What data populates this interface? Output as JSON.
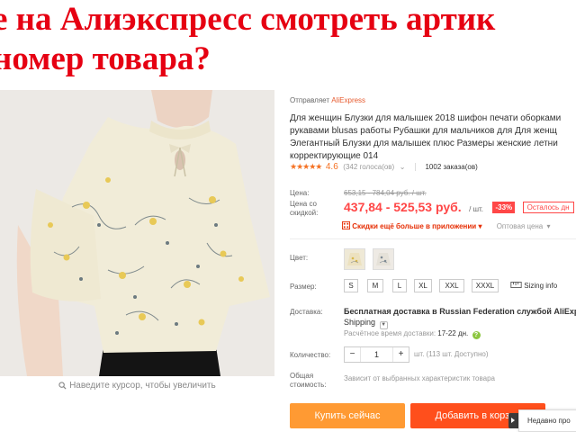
{
  "headline": {
    "line1": "е на Алиэкспресс смотреть артик",
    "line2": "номер товара?"
  },
  "gallery": {
    "zoom_hint": "Наведите курсор, чтобы увеличить"
  },
  "seller": {
    "prefix": "Отправляет",
    "name": "AliExpress"
  },
  "title_lines": [
    "Для женщин Блузки для малышек 2018 шифон печати оборками",
    "рукавами blusas работы Рубашки для мальчиков для Для женщ",
    "Элегантный Блузки для малышек плюс Размеры женские летни",
    "корректирующие 014"
  ],
  "rating": {
    "stars": "★★★★★",
    "value": "4.6",
    "votes": "(342 голоса(ов)",
    "orders": "1002 заказа(ов)"
  },
  "price": {
    "label": "Цена:",
    "old": "653,15 - 784,04 руб. / шт.",
    "discount_label": "Цена со скидкой:",
    "current": "437,84 - 525,53 руб.",
    "unit": "/ шт.",
    "discount": "-33%",
    "remaining": "Осталось дн",
    "app_discount": "Скидки ещё больше в приложении",
    "wholesale": "Оптовая цена"
  },
  "color": {
    "label": "Цвет:"
  },
  "size": {
    "label": "Размер:",
    "options": [
      "S",
      "M",
      "L",
      "XL",
      "XXL",
      "XXXL"
    ],
    "sizing_info": "Sizing info"
  },
  "shipping": {
    "label": "Доставка:",
    "method_bold": "Бесплатная доставка в Russian Federation службой AliExpres",
    "method_tail": "Shipping",
    "time_prefix": "Расчётное время доставки:",
    "time_days": "17-22 дн.",
    "help": "?"
  },
  "quantity": {
    "label": "Количество:",
    "value": "1",
    "minus": "−",
    "plus": "+",
    "note": "шт. (113 шт. Доступно)"
  },
  "total": {
    "label": "Общая стоимость:",
    "note": "Зависит от выбранных характеристик товара"
  },
  "actions": {
    "buy": "Купить сейчас",
    "cart": "Добавить в корзин"
  },
  "recent": {
    "label": "Недавно про"
  },
  "colors": {
    "accent_red": "#ff4747",
    "headline_red": "#e60012",
    "buy_orange": "#ff9a33",
    "cart_red": "#ff4f1c",
    "star_orange": "#f57224"
  }
}
